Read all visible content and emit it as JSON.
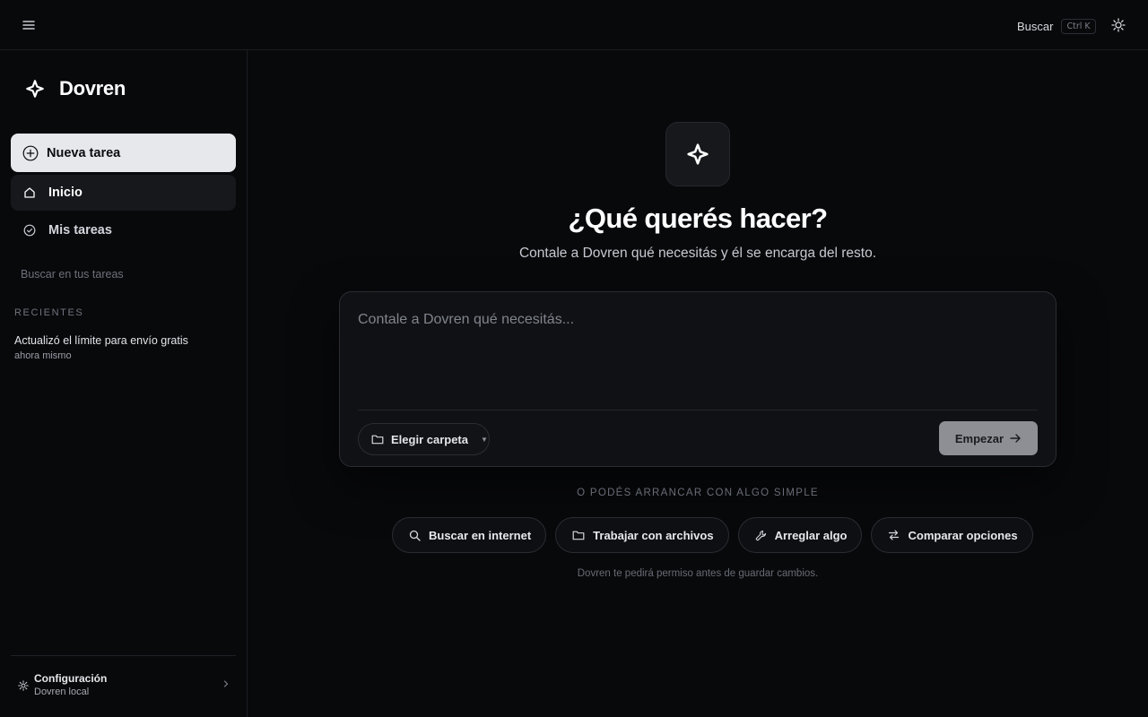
{
  "topbar": {
    "menu_icon": "hamburger-icon",
    "search_label": "Buscar",
    "search_shortcut": "Ctrl K",
    "theme_icon": "sun-icon"
  },
  "sidebar": {
    "brand": {
      "name": "Dovren",
      "icon": "sparkle-icon"
    },
    "new_task": {
      "label": "Nueva tarea",
      "icon": "plus-circle-icon"
    },
    "nav": [
      {
        "label": "Inicio",
        "icon": "home-icon",
        "active": true
      },
      {
        "label": "Mis tareas",
        "icon": "check-circle-icon",
        "active": false
      }
    ],
    "search_placeholder": "Buscar en tus tareas",
    "recent_heading": "RECIENTES",
    "recent": [
      {
        "title": "Actualizó el límite para envío gratis",
        "time": "ahora mismo"
      }
    ],
    "footer": {
      "title": "Configuración",
      "subtitle": "Dovren local",
      "icon": "gear-icon"
    }
  },
  "main": {
    "hero_icon": "sparkle-icon",
    "title": "¿Qué querés hacer?",
    "subtitle": "Contale a Dovren qué necesitás y él se encarga del resto.",
    "composer": {
      "placeholder": "Contale a Dovren qué necesitás...",
      "value": "",
      "folder_label": "Elegir carpeta",
      "start_label": "Empezar"
    },
    "or_label": "O PODÉS ARRANCAR CON ALGO SIMPLE",
    "suggestions": [
      {
        "label": "Buscar en internet",
        "icon": "search-icon"
      },
      {
        "label": "Trabajar con archivos",
        "icon": "folder-icon"
      },
      {
        "label": "Arreglar algo",
        "icon": "wrench-icon"
      },
      {
        "label": "Comparar opciones",
        "icon": "swap-icon"
      }
    ],
    "note": "Dovren te pedirá permiso antes de guardar cambios."
  },
  "colors": {
    "background": "#08090b",
    "primary_button": "#e6e8ec",
    "start_button": "#8d8f94"
  }
}
